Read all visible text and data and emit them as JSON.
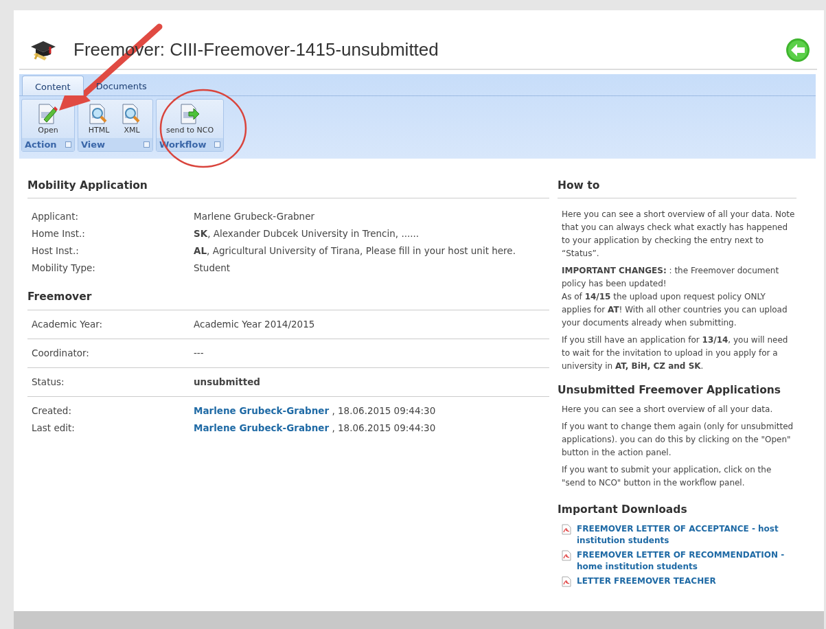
{
  "page": {
    "title": "Freemover: CIII-Freemover-1415-unsubmitted"
  },
  "ribbon": {
    "tabs": [
      {
        "label": "Content",
        "selected": true
      },
      {
        "label": "Documents",
        "selected": false
      }
    ],
    "groups": [
      {
        "label": "Action",
        "buttons": [
          {
            "label": "Open",
            "kind": "edit"
          }
        ]
      },
      {
        "label": "View",
        "buttons": [
          {
            "label": "HTML",
            "kind": "view"
          },
          {
            "label": "XML",
            "kind": "view"
          }
        ]
      },
      {
        "label": "Workflow",
        "buttons": [
          {
            "label": "send to NCO",
            "kind": "send"
          }
        ]
      }
    ]
  },
  "mobility_application": {
    "heading": "Mobility Application",
    "rows": [
      {
        "label": "Applicant:",
        "value": "Marlene Grubeck-Grabner",
        "kind": "text"
      },
      {
        "label": "Home Inst.:",
        "value": "**SK**, Alexander Dubcek University in Trencin, ......",
        "kind": "text"
      },
      {
        "label": "Host Inst.:",
        "value": "**AL**, Agricultural University of Tirana, Please fill in your host unit here.",
        "kind": "text"
      },
      {
        "label": "Mobility Type:",
        "value": "Student",
        "kind": "text"
      }
    ]
  },
  "freemover": {
    "heading": "Freemover",
    "groups": [
      [
        {
          "label": "Academic Year:",
          "value": "Academic Year 2014/2015",
          "kind": "text"
        }
      ],
      [
        {
          "label": "Coordinator:",
          "value": "---",
          "kind": "text"
        }
      ],
      [
        {
          "label": "Status:",
          "value": "unsubmitted",
          "kind": "bold"
        }
      ],
      [
        {
          "label": "Created:",
          "user": "Marlene Grubeck-Grabner",
          "value": ", 18.06.2015 09:44:30",
          "kind": "link"
        },
        {
          "label": "Last edit:",
          "user": "Marlene Grubeck-Grabner",
          "value": ", 18.06.2015 09:44:30",
          "kind": "link"
        }
      ]
    ]
  },
  "how_to": {
    "heading": "How to",
    "paragraphs": [
      "Here you can see a short overview of all your data. Note that you can always check what exactly has happened to your application by checking the entry next to “Status”.",
      "**IMPORTANT CHANGES:**  : the Freemover document policy has been updated!",
      "As of **14/15** the upload upon request policy ONLY applies for **AT**! With all other countries you can upload your documents already when submitting.",
      "If you still have an application for **13/14**, you will need to wait for the invitation to upload in you apply for a university in **AT, BiH, CZ and SK**."
    ]
  },
  "unsubmitted": {
    "heading": "Unsubmitted Freemover Applications",
    "paragraphs": [
      "Here you can see a short overview of all your data.",
      "If you want to change them again (only for unsubmitted applications). you can do this by clicking on the \"Open\" button in the action panel.",
      "If you want to submit your application, click on the \"send to NCO\" button in the workflow panel."
    ]
  },
  "downloads": {
    "heading": "Important Downloads",
    "items": [
      "FREEMOVER LETTER OF ACCEPTANCE - host institution students",
      "FREEMOVER LETTER OF RECOMMENDATION - home institution students",
      "LETTER FREEMOVER TEACHER"
    ]
  }
}
